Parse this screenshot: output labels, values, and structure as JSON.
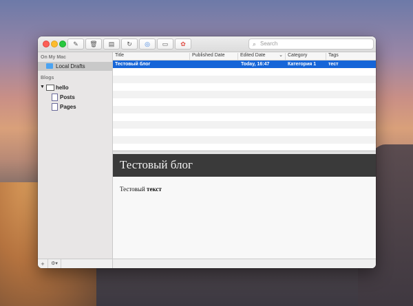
{
  "toolbar": {
    "search_placeholder": "Search",
    "buttons": {
      "compose": "✎",
      "trash": "🗑",
      "document": "▤",
      "refresh": "↻",
      "browser": "◎",
      "layout": "▭",
      "photos": "✿"
    }
  },
  "sidebar": {
    "section_mac": "On My Mac",
    "local_drafts": "Local Drafts",
    "section_blogs": "Blogs",
    "blog_name": "hello",
    "posts": "Posts",
    "pages": "Pages",
    "footer_add": "+",
    "footer_gear": "⚙▾"
  },
  "table": {
    "columns": {
      "title": "Title",
      "published": "Published Date",
      "edited": "Edited Date",
      "category": "Category",
      "tags": "Tags"
    },
    "sort_indicator": "⌄",
    "rows": [
      {
        "title": "Тестовый блог",
        "published": "",
        "edited": "Today, 16:47",
        "category": "Категория 1",
        "tags": "тест"
      }
    ]
  },
  "preview": {
    "heading": "Тестовый блог",
    "body_plain": "Тестовый ",
    "body_bold": "текст"
  },
  "colors": {
    "selection": "#1565d8",
    "preview_header": "#3a3a3a"
  }
}
